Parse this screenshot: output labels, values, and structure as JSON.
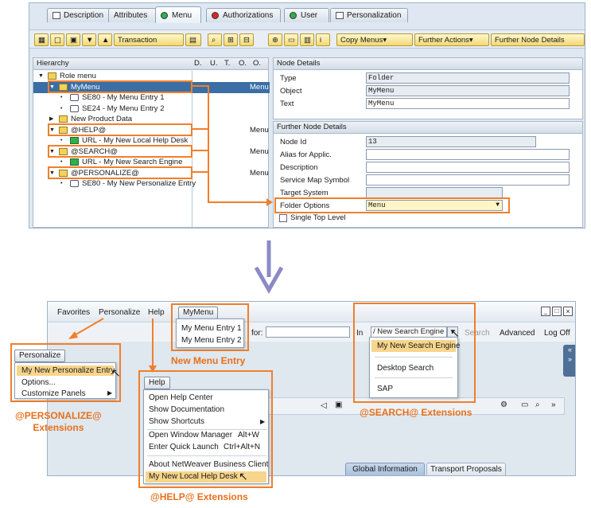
{
  "top": {
    "tabs": [
      "Description",
      "Attributes",
      "Menu",
      "Authorizations",
      "User",
      "Personalization"
    ],
    "toolbar": {
      "transaction": "Transaction",
      "copy_menus": "Copy Menus",
      "further_actions": "Further Actions",
      "further_node": "Further Node Details"
    },
    "hierarchy": {
      "title": "Hierarchy",
      "cols": [
        "D.",
        "U.",
        "T.",
        "O.",
        "O."
      ],
      "rows": [
        {
          "label": "Role menu",
          "indent": 0,
          "right": ""
        },
        {
          "label": "MyMenu",
          "indent": 1,
          "right": "Menu"
        },
        {
          "label": "SE80 - My Menu Entry 1",
          "indent": 2,
          "right": ""
        },
        {
          "label": "SE24 - My Menu Entry 2",
          "indent": 2,
          "right": ""
        },
        {
          "label": "New Product Data",
          "indent": 1,
          "right": ""
        },
        {
          "label": "@HELP@",
          "indent": 1,
          "right": "Menu"
        },
        {
          "label": "URL - My New Local Help Desk",
          "indent": 2,
          "right": ""
        },
        {
          "label": "@SEARCH@",
          "indent": 1,
          "right": "Menu"
        },
        {
          "label": "URL - My New Search Engine",
          "indent": 2,
          "right": ""
        },
        {
          "label": "@PERSONALIZE@",
          "indent": 1,
          "right": "Menu"
        },
        {
          "label": "SE80 - My New Personalize Entry",
          "indent": 2,
          "right": ""
        }
      ]
    },
    "node_details": {
      "title": "Node Details",
      "type_label": "Type",
      "type_value": "Folder",
      "object_label": "Object",
      "object_value": "MyMenu",
      "text_label": "Text",
      "text_value": "MyMenu"
    },
    "further": {
      "title": "Further Node Details",
      "node_id_label": "Node Id",
      "node_id_value": "13",
      "alias_label": "Alias for Applic.",
      "desc_label": "Description",
      "service_label": "Service Map Symbol",
      "target_label": "Target System",
      "folder_label": "Folder Options",
      "folder_value": "Menu",
      "single_label": "Single Top Level"
    }
  },
  "bottom": {
    "menubar": [
      "Favorites",
      "Personalize",
      "Help"
    ],
    "mymenu_btn": "MyMenu",
    "mymenu_items": [
      "My Menu Entry 1",
      "My Menu Entry 2"
    ],
    "for_label": "for:",
    "in_label": "In",
    "search_engine": "/ New Search Engine",
    "search_btn": "Search",
    "advanced": "Advanced",
    "logoff": "Log Off",
    "search_items": [
      "My New Search Engine",
      "Desktop Search",
      "SAP"
    ],
    "personalize_btn": "Personalize",
    "personalize_items": [
      "My New Personalize Entry",
      "Options...",
      "Customize Panels"
    ],
    "help_btn": "Help",
    "help_items": [
      "Open Help Center",
      "Show Documentation",
      "Show Shortcuts",
      "Open Window Manager",
      "Enter Quick Launch",
      "About NetWeaver Business Client",
      "My New Local Help Desk"
    ],
    "shortcuts": {
      "window": "Alt+W",
      "launch": "Ctrl+Alt+N"
    },
    "bottom_tabs": [
      "Global Information",
      "Transport Proposals"
    ]
  },
  "captions": {
    "menu": "New Menu Entry",
    "personalize": "@PERSONALIZE@\nExtensions",
    "search": "@SEARCH@ Extensions",
    "help": "@HELP@ Extensions"
  },
  "colors": {
    "accent": "#f07f2b",
    "selection": "#3a6ea5",
    "arrow": "#8a8ac8"
  }
}
